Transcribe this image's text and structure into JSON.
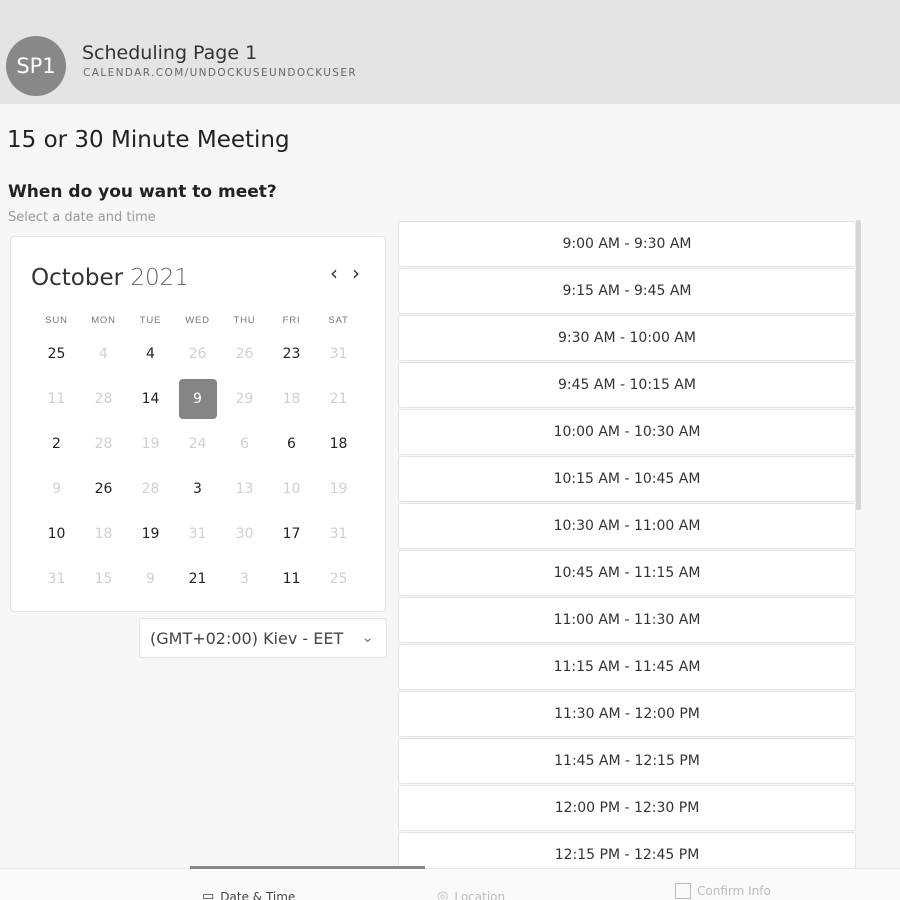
{
  "header": {
    "avatar": "SP1",
    "page_name": "Scheduling Page 1",
    "url": "CALENDAR.COM/UNDOCKUSEUNDOCKUSER"
  },
  "meeting": {
    "title": "15 or 30 Minute Meeting",
    "question": "When do you want to meet?",
    "instruction": "Select a date and time"
  },
  "calendar": {
    "month": "October",
    "year": "2021",
    "prev_icon": "‹",
    "next_icon": "›",
    "weekdays": [
      "SUN",
      "MON",
      "TUE",
      "WED",
      "THU",
      "FRI",
      "SAT"
    ],
    "days": [
      {
        "label": "25",
        "state": "available"
      },
      {
        "label": "4",
        "state": "disabled"
      },
      {
        "label": "4",
        "state": "available"
      },
      {
        "label": "26",
        "state": "disabled"
      },
      {
        "label": "26",
        "state": "disabled"
      },
      {
        "label": "23",
        "state": "available"
      },
      {
        "label": "31",
        "state": "disabled"
      },
      {
        "label": "11",
        "state": "disabled"
      },
      {
        "label": "28",
        "state": "disabled"
      },
      {
        "label": "14",
        "state": "available"
      },
      {
        "label": "9",
        "state": "selected"
      },
      {
        "label": "29",
        "state": "disabled"
      },
      {
        "label": "18",
        "state": "disabled"
      },
      {
        "label": "21",
        "state": "disabled"
      },
      {
        "label": "2",
        "state": "available"
      },
      {
        "label": "28",
        "state": "disabled"
      },
      {
        "label": "19",
        "state": "disabled"
      },
      {
        "label": "24",
        "state": "disabled"
      },
      {
        "label": "6",
        "state": "disabled"
      },
      {
        "label": "6",
        "state": "available"
      },
      {
        "label": "18",
        "state": "available"
      },
      {
        "label": "9",
        "state": "disabled"
      },
      {
        "label": "26",
        "state": "available"
      },
      {
        "label": "28",
        "state": "disabled"
      },
      {
        "label": "3",
        "state": "available"
      },
      {
        "label": "13",
        "state": "disabled"
      },
      {
        "label": "10",
        "state": "disabled"
      },
      {
        "label": "19",
        "state": "disabled"
      },
      {
        "label": "10",
        "state": "available"
      },
      {
        "label": "18",
        "state": "disabled"
      },
      {
        "label": "19",
        "state": "available"
      },
      {
        "label": "31",
        "state": "disabled"
      },
      {
        "label": "30",
        "state": "disabled"
      },
      {
        "label": "17",
        "state": "available"
      },
      {
        "label": "31",
        "state": "disabled"
      },
      {
        "label": "31",
        "state": "disabled"
      },
      {
        "label": "15",
        "state": "disabled"
      },
      {
        "label": "9",
        "state": "disabled"
      },
      {
        "label": "21",
        "state": "available"
      },
      {
        "label": "3",
        "state": "disabled"
      },
      {
        "label": "11",
        "state": "available"
      },
      {
        "label": "25",
        "state": "disabled"
      }
    ]
  },
  "timezone": {
    "value": "(GMT+02:00) Kiev - EET",
    "chevron_icon": "⌄"
  },
  "time_slots": [
    "9:00 AM - 9:30 AM",
    "9:15 AM - 9:45 AM",
    "9:30 AM - 10:00 AM",
    "9:45 AM - 10:15 AM",
    "10:00 AM - 10:30 AM",
    "10:15 AM - 10:45 AM",
    "10:30 AM - 11:00 AM",
    "10:45 AM - 11:15 AM",
    "11:00 AM - 11:30 AM",
    "11:15 AM - 11:45 AM",
    "11:30 AM - 12:00 PM",
    "11:45 AM - 12:15 PM",
    "12:00 PM - 12:30 PM",
    "12:15 PM - 12:45 PM"
  ],
  "steps": {
    "datetime": {
      "label": "Date & Time",
      "icon": "calendar-icon",
      "active": true
    },
    "location": {
      "label": "Location",
      "icon": "location-pin-icon",
      "active": false
    },
    "confirm": {
      "label": "Confirm Info",
      "icon": "checkbox-icon",
      "active": false
    }
  }
}
